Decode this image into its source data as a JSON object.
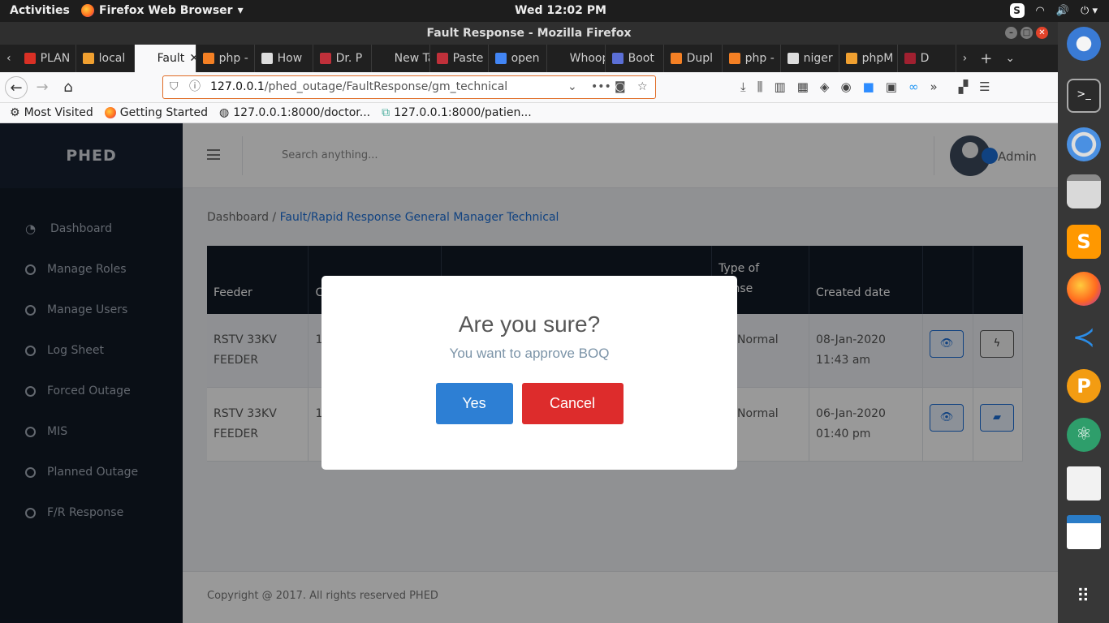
{
  "system": {
    "activities": "Activities",
    "app_name": "Firefox Web Browser",
    "clock": "Wed 12:02 PM"
  },
  "window": {
    "title": "Fault Response - Mozilla Firefox"
  },
  "tabs": [
    {
      "label": "PLAN",
      "color": "#d93025"
    },
    {
      "label": "local",
      "color": "#f0a030"
    },
    {
      "label": "Fault",
      "color": "#f9f9fa",
      "active": true
    },
    {
      "label": "php -",
      "color": "#f48024"
    },
    {
      "label": "How",
      "color": "#ddd"
    },
    {
      "label": "Dr. P",
      "color": "#c0303a"
    },
    {
      "label": "New Tab",
      "color": "#202020"
    },
    {
      "label": "Paste",
      "color": "#c0303a"
    },
    {
      "label": "open",
      "color": "#4285f4"
    },
    {
      "label": "Whoops",
      "color": "#202020"
    },
    {
      "label": "Boot",
      "color": "#5b6fd6"
    },
    {
      "label": "Dupl",
      "color": "#f48024"
    },
    {
      "label": "php -",
      "color": "#f48024"
    },
    {
      "label": "niger",
      "color": "#ddd"
    },
    {
      "label": "phpM",
      "color": "#f0a030"
    },
    {
      "label": "D",
      "color": "#a02030"
    }
  ],
  "url": {
    "host": "127.0.0.1",
    "path": "/phed_outage/FaultResponse/gm_technical"
  },
  "bookmarks": {
    "b1": "Most Visited",
    "b2": "Getting Started",
    "b3": "127.0.0.1:8000/doctor...",
    "b4": "127.0.0.1:8000/patien..."
  },
  "app": {
    "brand": "PHED",
    "search_placeholder": "Search anything...",
    "user": "Admin"
  },
  "sidebar": {
    "items": [
      {
        "label": "Dashboard"
      },
      {
        "label": "Manage Roles"
      },
      {
        "label": "Manage Users"
      },
      {
        "label": "Log Sheet"
      },
      {
        "label": "Forced Outage"
      },
      {
        "label": "MIS"
      },
      {
        "label": "Planned Outage"
      },
      {
        "label": "F/R Response"
      }
    ]
  },
  "breadcrumb": {
    "home": "Dashboard",
    "sep": "/",
    "current": "Fault/Rapid Response General Manager Technical"
  },
  "table": {
    "headers": [
      "Feeder",
      "C",
      "",
      "Type of Response",
      "Created date",
      "",
      ""
    ],
    "header_visible": {
      "c1": "C",
      "c3a": "Type of",
      "c3b": "ponse"
    },
    "rows": [
      {
        "feeder_a": "RSTV 33KV",
        "feeder_b": "FEEDER",
        "c": "1",
        "type": "ult/Normal",
        "date": "08-Jan-2020",
        "time": "11:43 am"
      },
      {
        "feeder_a": "RSTV 33KV",
        "feeder_b": "FEEDER",
        "c": "1",
        "type": "ult/Normal",
        "date": "06-Jan-2020",
        "time": "01:40 pm"
      }
    ]
  },
  "footer": "Copyright @ 2017. All rights reserved PHED",
  "modal": {
    "title": "Are you sure?",
    "text": "You want to approve BOQ",
    "yes": "Yes",
    "cancel": "Cancel"
  }
}
